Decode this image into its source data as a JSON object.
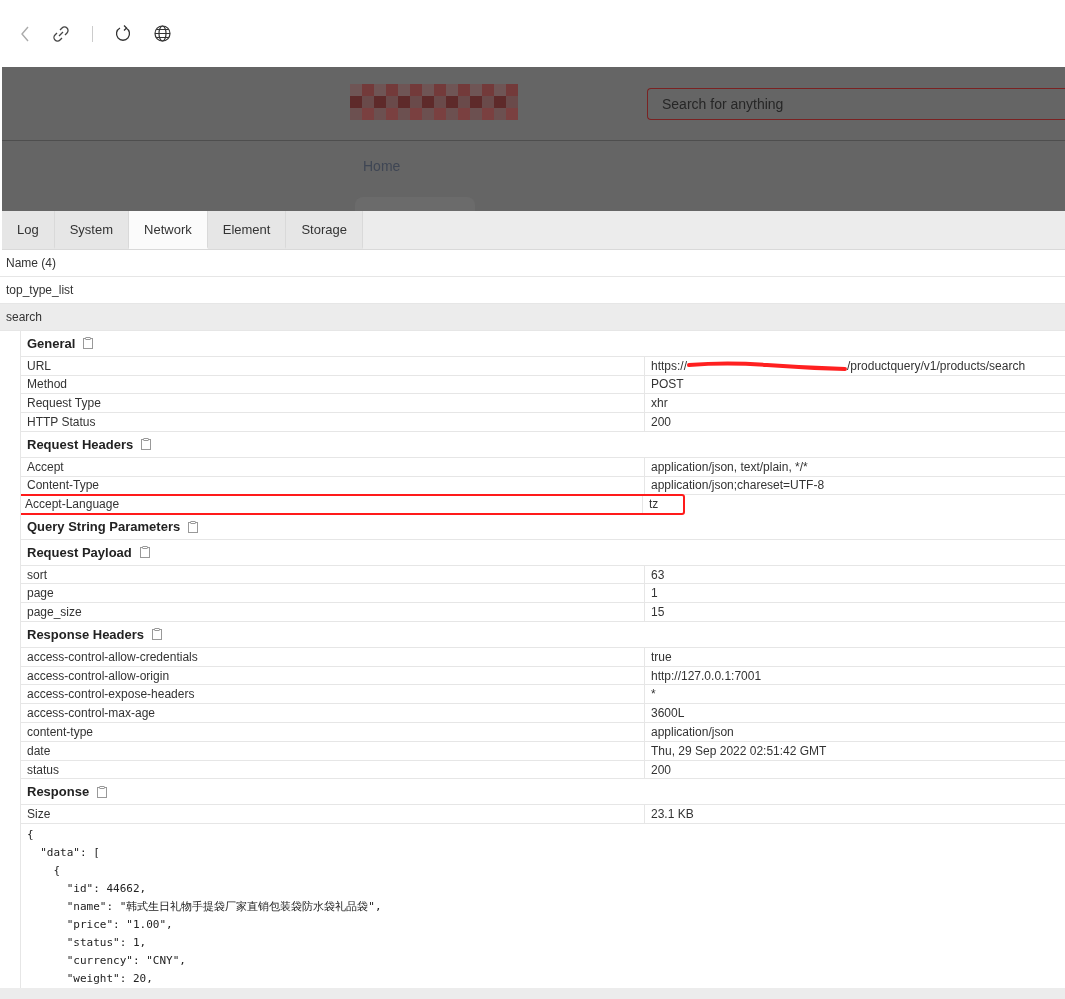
{
  "header": {
    "search": {
      "placeholder": "Search for anything"
    },
    "nav": [
      "Home"
    ]
  },
  "tabs": [
    {
      "label": "Log",
      "selected": false
    },
    {
      "label": "System",
      "selected": false
    },
    {
      "label": "Network",
      "selected": true
    },
    {
      "label": "Element",
      "selected": false
    },
    {
      "label": "Storage",
      "selected": false
    }
  ],
  "requests": {
    "heading": "Name (4)",
    "items": [
      {
        "name": "top_type_list",
        "expanded": false
      },
      {
        "name": "search",
        "expanded": true
      }
    ]
  },
  "sections": [
    {
      "title": "General",
      "rows": [
        {
          "key": "URL",
          "value": "https://",
          "value_rest": "/productquery/v1/products/search",
          "redacted": true,
          "highlighted": false
        },
        {
          "key": "Method",
          "value": "POST",
          "redacted": false,
          "highlighted": false
        },
        {
          "key": "Request Type",
          "value": "xhr",
          "redacted": false,
          "highlighted": false
        },
        {
          "key": "HTTP Status",
          "value": "200",
          "redacted": false,
          "highlighted": false
        }
      ]
    },
    {
      "title": "Request Headers",
      "rows": [
        {
          "key": "Accept",
          "value": "application/json, text/plain, */*",
          "redacted": false,
          "highlighted": false
        },
        {
          "key": "Content-Type",
          "value": "application/json;chareset=UTF-8",
          "redacted": false,
          "highlighted": false
        },
        {
          "key": "Accept-Language",
          "value": "tz",
          "redacted": false,
          "highlighted": true
        }
      ]
    },
    {
      "title": "Query String Parameters"
    },
    {
      "title": "Request Payload",
      "rows": [
        {
          "key": "sort",
          "value": "63",
          "redacted": false,
          "highlighted": false
        },
        {
          "key": "page",
          "value": "1",
          "redacted": false,
          "highlighted": false
        },
        {
          "key": "page_size",
          "value": "15",
          "redacted": false,
          "highlighted": false
        }
      ]
    },
    {
      "title": "Response Headers",
      "rows": [
        {
          "key": "access-control-allow-credentials",
          "value": "true",
          "redacted": false,
          "highlighted": false
        },
        {
          "key": "access-control-allow-origin",
          "value": "http://127.0.0.1:7001",
          "redacted": false,
          "highlighted": false
        },
        {
          "key": "access-control-expose-headers",
          "value": "*",
          "redacted": false,
          "highlighted": false
        },
        {
          "key": "access-control-max-age",
          "value": "3600L",
          "redacted": false,
          "highlighted": false
        },
        {
          "key": "content-type",
          "value": "application/json",
          "redacted": false,
          "highlighted": false
        },
        {
          "key": "date",
          "value": "Thu, 29 Sep 2022 02:51:42 GMT",
          "redacted": false,
          "highlighted": false
        },
        {
          "key": "status",
          "value": "200",
          "redacted": false,
          "highlighted": false
        }
      ]
    },
    {
      "title": "Response",
      "rows": [
        {
          "key": "Size",
          "value": "23.1 KB",
          "redacted": false,
          "highlighted": false
        }
      ]
    }
  ],
  "response_body": [
    "{",
    "  \"data\": [",
    "    {",
    "      \"id\": 44662,",
    "      \"name\": \"韩式生日礼物手提袋厂家直销包装袋防水袋礼品袋\",",
    "      \"price\": \"1.00\",",
    "      \"status\": 1,",
    "      \"currency\": \"CNY\",",
    "      \"weight\": 20,"
  ]
}
